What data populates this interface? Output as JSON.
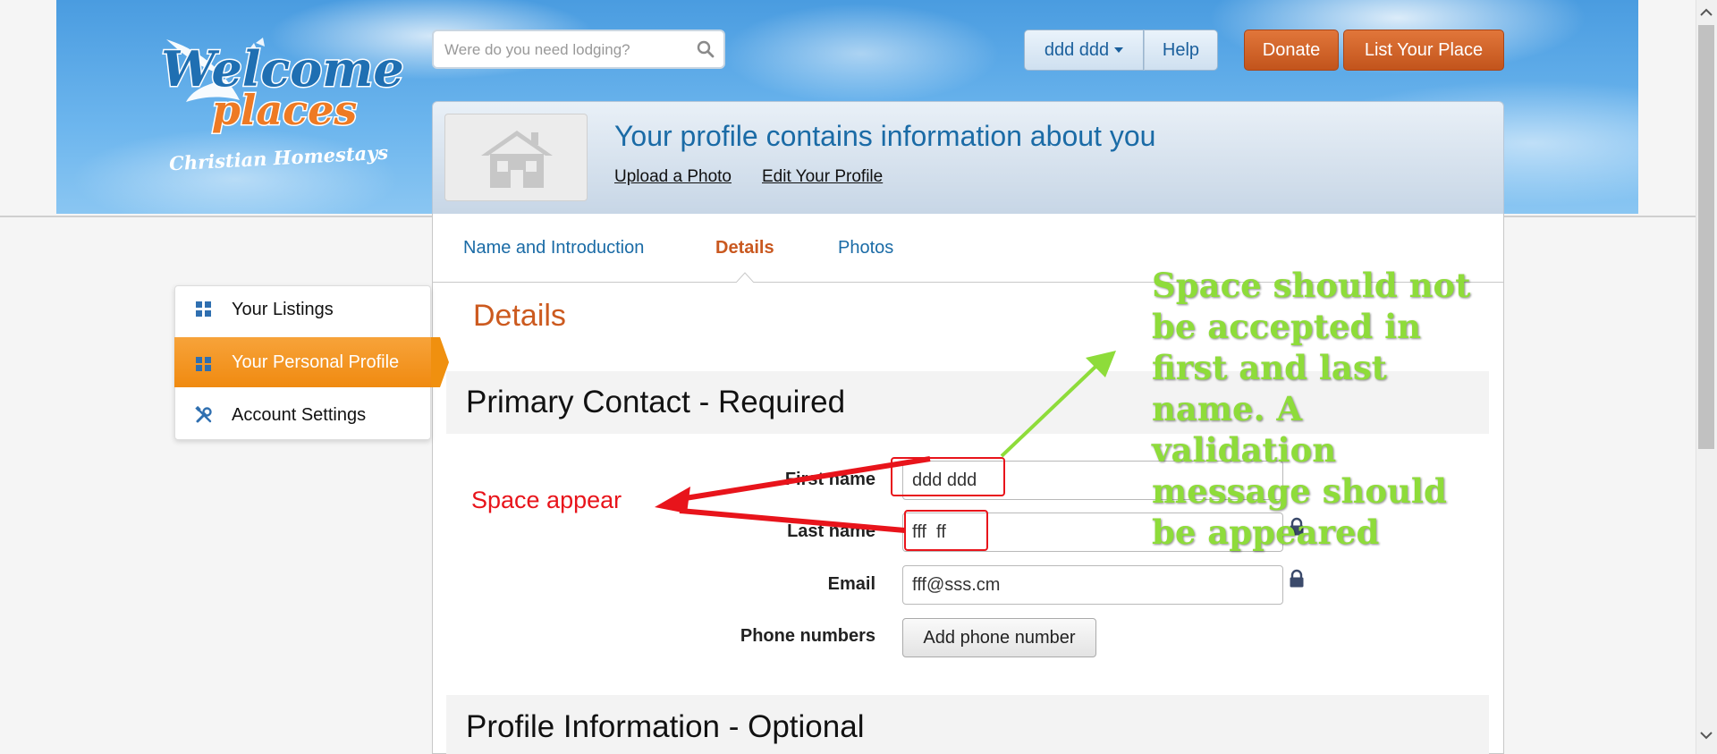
{
  "header": {
    "logo": {
      "line1": "Welcome",
      "line2": "places",
      "tagline": "Christian Homestays"
    },
    "search": {
      "placeholder": "Were do you need lodging?",
      "value": ""
    },
    "user_menu_label": "ddd ddd",
    "help_label": "Help",
    "donate_label": "Donate",
    "list_place_label": "List Your Place"
  },
  "profile": {
    "title": "Your profile contains information about you",
    "upload_photo_link": "Upload a Photo",
    "edit_profile_link": "Edit Your Profile"
  },
  "tabs": [
    {
      "label": "Name and Introduction",
      "active": false
    },
    {
      "label": "Details",
      "active": true
    },
    {
      "label": "Photos",
      "active": false
    }
  ],
  "main": {
    "heading": "Details",
    "section_primary": "Primary Contact - Required",
    "section_profile": "Profile Information - Optional",
    "fields": {
      "first_name": {
        "label": "First name",
        "value": "ddd ddd"
      },
      "last_name": {
        "label": "Last name",
        "value": "fff  ff"
      },
      "email": {
        "label": "Email",
        "value": "fff@sss.cm"
      },
      "phone": {
        "label": "Phone numbers",
        "button": "Add phone number"
      }
    }
  },
  "sidebar": {
    "items": [
      {
        "label": "Your Listings",
        "active": false
      },
      {
        "label": "Your Personal Profile",
        "active": true
      },
      {
        "label": "Account Settings",
        "active": false
      }
    ]
  },
  "annotations": {
    "space_appear": "Space appear",
    "validation_note": "Space should not be accepted in first and last name. A validation message should be appeared",
    "red_color": "#e8141b",
    "green_color": "#8edc3a"
  },
  "colors": {
    "brand_orange": "#e06a2a",
    "link_blue": "#1a6ba6",
    "sidebar_active": "#f39a22"
  }
}
